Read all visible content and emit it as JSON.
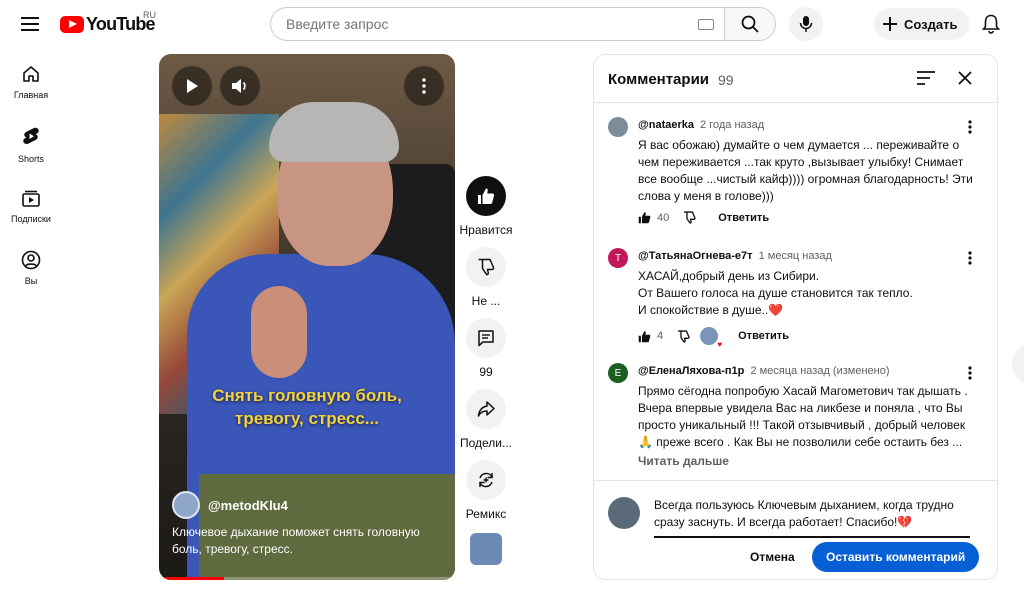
{
  "brand": {
    "logo_text": "YouTube",
    "region": "RU",
    "accent": "#ff0000"
  },
  "search": {
    "placeholder": "Введите запрос"
  },
  "header": {
    "create_label": "Создать"
  },
  "sidebar": {
    "items": [
      {
        "label": "Главная",
        "icon": "home-icon"
      },
      {
        "label": "Shorts",
        "icon": "shorts-icon"
      },
      {
        "label": "Подписки",
        "icon": "subscriptions-icon"
      },
      {
        "label": "Вы",
        "icon": "you-icon"
      }
    ]
  },
  "video": {
    "caption_line1": "Снять головную боль,",
    "caption_line2": "тревогу, стресс...",
    "channel": "@metodKlu4",
    "description": "Ключевое дыхание поможет снять головную боль, тревогу, стресс.",
    "progress": 0.22
  },
  "actions": {
    "like_label": "Нравится",
    "dislike_label": "Не ...",
    "comments_count": "99",
    "share_label": "Подели...",
    "remix_label": "Ремикс"
  },
  "comments_panel": {
    "title": "Комментарии",
    "count": "99",
    "items": [
      {
        "author": "@nataerka",
        "time": "2 года назад",
        "text": "Я вас обожаю) думайте о чем думается ... переживайте о чем переживается ...так круто ,вызывает улыбку! Снимает все вообще ...чистый кайф)))) огромная благодарность! Эти слова у меня в голове)))",
        "likes": "40",
        "reply": "Ответить",
        "avatar_color": "#7e8c9a"
      },
      {
        "author": "@ТатьянаОгнева-е7т",
        "time": "1 месяц назад",
        "text_line1": "ХАСАЙ,добрый день из Сибири.",
        "text_line2": "От Вашего голоса на душе становится так тепло.",
        "text_line3": "И спокойствие в душе..❤️",
        "likes": "4",
        "reply": "Ответить",
        "avatar_letter": "Т",
        "avatar_color": "#c2185b"
      },
      {
        "author": "@ЕленаЛяхова-п1р",
        "time": "2 месяца назад (изменено)",
        "text": "Прямо сёгодна попробую Хасай Магометович так дышать . Вчера впервые увидела Вас на ликбезе  и поняла , что Вы просто уникальный !!! Такой отзывчивый , добрый человек 🙏 преже всего . Как Вы не позволили себе остаить без ...",
        "read_more": "Читать дальше",
        "avatar_letter": "Е",
        "avatar_color": "#1b5e20"
      }
    ],
    "composer": {
      "draft": "Всегда пользуюсь Ключевым дыханием, когда трудно сразу заснуть. И всегда работает! Спасибо!💔",
      "cancel": "Отмена",
      "submit": "Оставить комментарий",
      "submit_color": "#065fd4"
    }
  }
}
